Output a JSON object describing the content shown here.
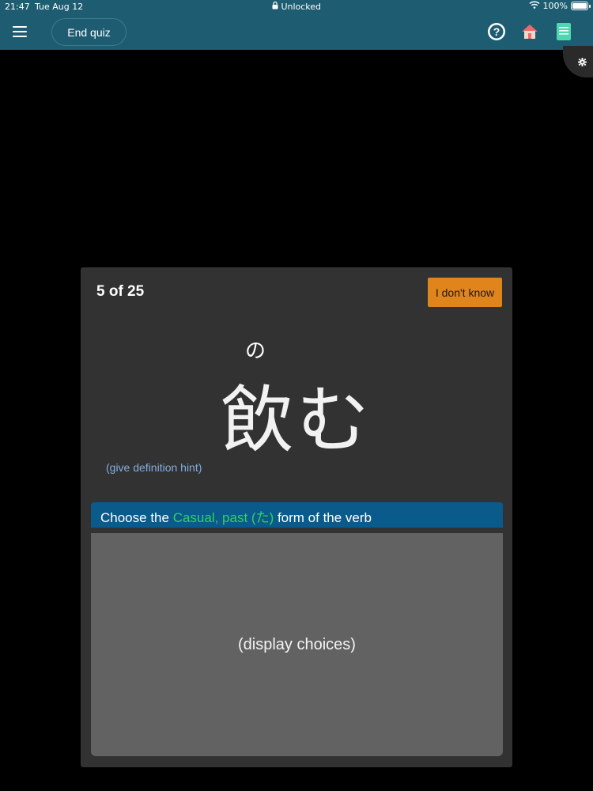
{
  "status_bar": {
    "time": "21:47",
    "date": "Tue Aug 12",
    "center": "Unlocked",
    "battery": "100%"
  },
  "header": {
    "end_quiz_label": "End quiz",
    "icons": [
      "hamburger-menu-icon",
      "help-icon",
      "home-icon",
      "notebook-icon"
    ],
    "background": "#1e5c72"
  },
  "card": {
    "counter": "5 of 25",
    "dont_know_label": "I don't know",
    "furigana": "の",
    "word": "飲む",
    "hint": "(give definition hint)",
    "prompt_prefix": "Choose the ",
    "prompt_form": "Casual, past (た)",
    "prompt_suffix": " form of the verb",
    "choices_placeholder": "(display choices)"
  },
  "colors": {
    "accent_orange": "#e0841c",
    "prompt_blue": "#0a5a8c",
    "form_green": "#33d15a",
    "hint_blue": "#84aee0"
  }
}
